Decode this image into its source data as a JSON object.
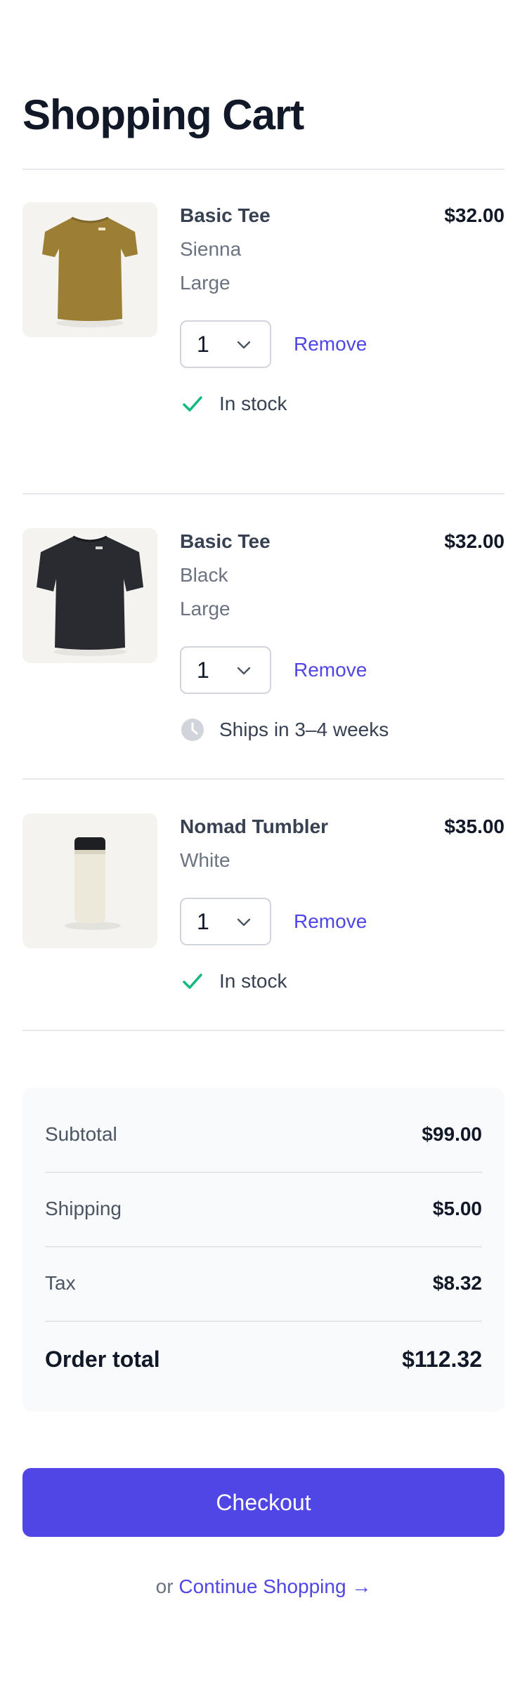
{
  "page_title": "Shopping Cart",
  "cart_items": [
    {
      "name": "Basic Tee",
      "price": "$32.00",
      "color": "Sienna",
      "size": "Large",
      "quantity": "1",
      "remove_label": "Remove",
      "status_text": "In stock",
      "status_icon": "check-icon",
      "image_color": "#9c7f35"
    },
    {
      "name": "Basic Tee",
      "price": "$32.00",
      "color": "Black",
      "size": "Large",
      "quantity": "1",
      "remove_label": "Remove",
      "status_text": "Ships in 3–4 weeks",
      "status_icon": "clock-icon",
      "image_color": "#2a2b30"
    },
    {
      "name": "Nomad Tumbler",
      "price": "$35.00",
      "color": "White",
      "quantity": "1",
      "remove_label": "Remove",
      "status_text": "In stock",
      "status_icon": "check-icon",
      "image_color": "#ece8da"
    }
  ],
  "summary": {
    "subtotal_label": "Subtotal",
    "subtotal_value": "$99.00",
    "shipping_label": "Shipping",
    "shipping_value": "$5.00",
    "tax_label": "Tax",
    "tax_value": "$8.32",
    "total_label": "Order total",
    "total_value": "$112.32"
  },
  "checkout_label": "Checkout",
  "continue": {
    "prefix": "or",
    "link_label": "Continue Shopping →"
  },
  "colors": {
    "accent": "#4f46e5",
    "in_stock": "#10b981",
    "clock": "#d1d5db"
  }
}
